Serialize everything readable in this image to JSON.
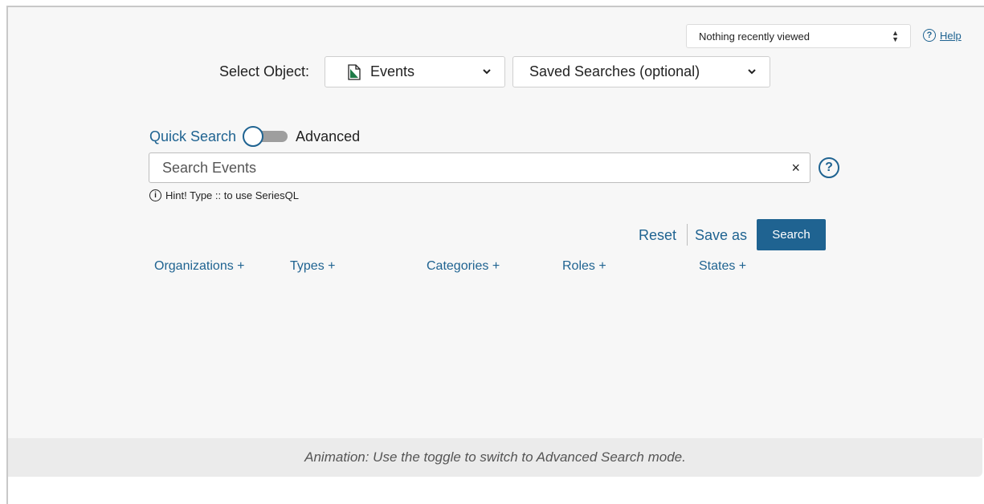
{
  "header": {
    "recently_viewed": "Nothing recently viewed",
    "help_label": "Help"
  },
  "object_select": {
    "label": "Select Object:",
    "selected": "Events",
    "saved_searches": "Saved Searches (optional)"
  },
  "mode": {
    "quick_label": "Quick Search",
    "advanced_label": "Advanced"
  },
  "search": {
    "placeholder": "Search Events",
    "clear_glyph": "×",
    "help_glyph": "?",
    "hint": "Hint! Type :: to use SeriesQL",
    "info_glyph": "i"
  },
  "actions": {
    "reset": "Reset",
    "save_as": "Save as",
    "search": "Search"
  },
  "filters": [
    "Organizations +",
    "Types +",
    "Categories +",
    "Roles +",
    "States +"
  ],
  "caption": "Animation: Use the toggle to switch to Advanced Search mode.",
  "colors": {
    "accent": "#1f6391",
    "doc_icon_green": "#1e7a47",
    "panel_bg": "#f7f7f7",
    "caption_bg": "#ebebeb"
  }
}
